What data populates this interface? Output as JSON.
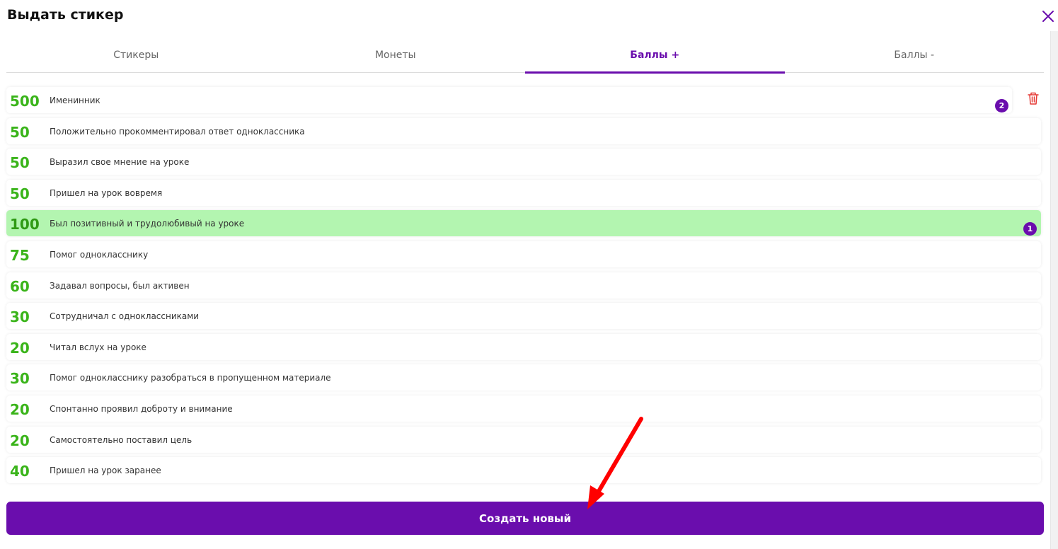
{
  "dialog": {
    "title": "Выдать стикер"
  },
  "tabs": [
    {
      "label": "Стикеры",
      "active": false
    },
    {
      "label": "Монеты",
      "active": false
    },
    {
      "label": "Баллы +",
      "active": true
    },
    {
      "label": "Баллы -",
      "active": false
    }
  ],
  "items": [
    {
      "points": "500",
      "label": "Именинник",
      "badge": "2",
      "selected": false
    },
    {
      "points": "50",
      "label": "Положительно прокомментировал ответ одноклассника"
    },
    {
      "points": "50",
      "label": "Выразил свое мнение на уроке"
    },
    {
      "points": "50",
      "label": "Пришел на урок вовремя"
    },
    {
      "points": "100",
      "label": "Был позитивный и трудолюбивый на уроке",
      "badge": "1",
      "selected": true
    },
    {
      "points": "75",
      "label": "Помог однокласснику"
    },
    {
      "points": "60",
      "label": "Задавал вопросы, был активен"
    },
    {
      "points": "30",
      "label": "Сотрудничал с одноклассниками"
    },
    {
      "points": "20",
      "label": "Читал вслух на уроке"
    },
    {
      "points": "30",
      "label": "Помог однокласснику разобраться в пропущенном материале"
    },
    {
      "points": "20",
      "label": "Спонтанно проявил доброту и внимание"
    },
    {
      "points": "20",
      "label": "Самостоятельно поставил цель"
    },
    {
      "points": "40",
      "label": "Пришел на урок заранее"
    }
  ],
  "actions": {
    "create_label": "Создать новый"
  },
  "colors": {
    "accent": "#6a0dad",
    "points": "#3ab41a",
    "selected_bg": "#b3f5b0",
    "delete": "#e53935",
    "annotation_arrow": "#ff0000"
  },
  "icons": {
    "close": "close-icon",
    "delete": "trash-icon"
  }
}
